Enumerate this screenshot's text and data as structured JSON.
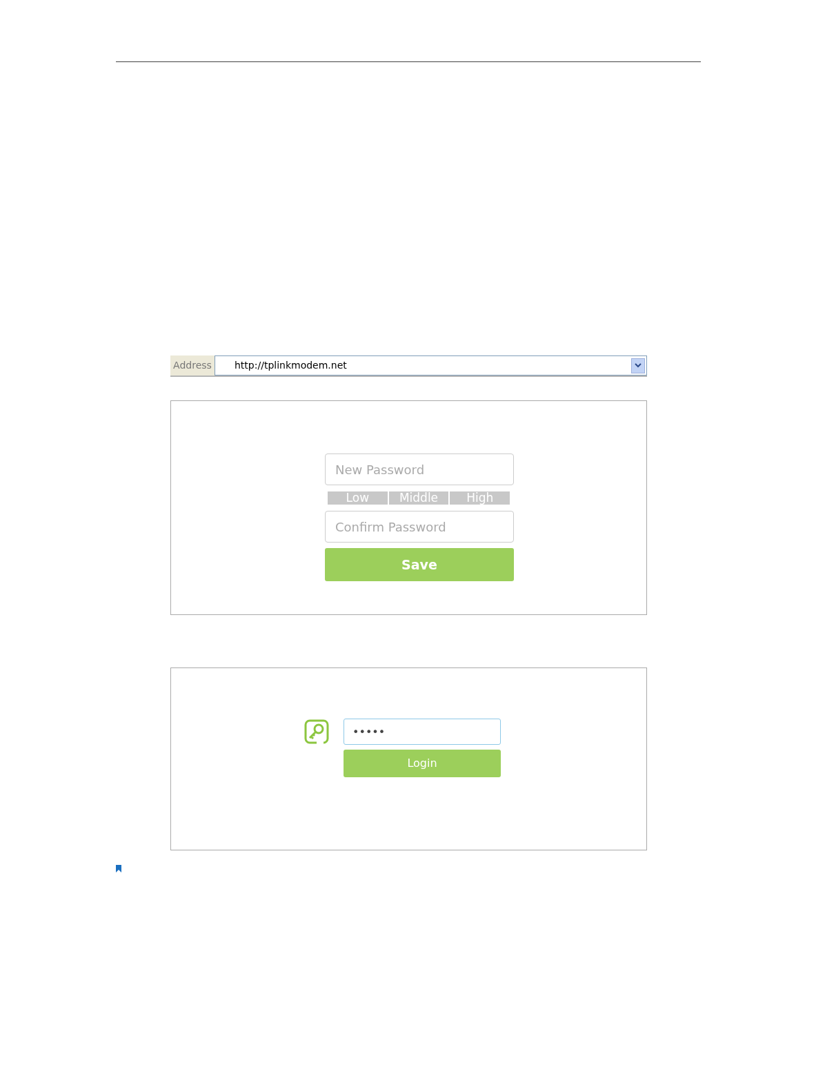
{
  "address_bar": {
    "label": "Address",
    "url": "http://tplinkmodem.net"
  },
  "password_setup": {
    "new_password": {
      "placeholder": "New Password"
    },
    "strength": [
      {
        "label": "Low",
        "active": false
      },
      {
        "label": "Middle",
        "active": false
      },
      {
        "label": "High",
        "active": false
      }
    ],
    "confirm_password": {
      "placeholder": "Confirm Password"
    },
    "save_button": "Save"
  },
  "login": {
    "password_value": "•••••",
    "login_button": "Login"
  }
}
